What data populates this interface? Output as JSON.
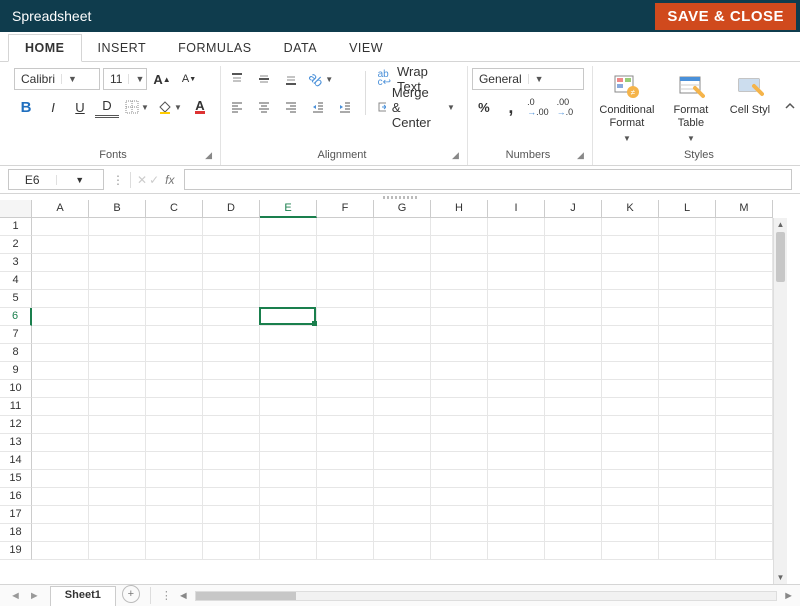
{
  "titlebar": {
    "title": "Spreadsheet",
    "save_close": "SAVE & CLOSE"
  },
  "tabs": {
    "home": "HOME",
    "insert": "INSERT",
    "formulas": "FORMULAS",
    "data": "DATA",
    "view": "VIEW",
    "active": "HOME"
  },
  "ribbon": {
    "fonts": {
      "label": "Fonts",
      "font_name": "Calibri",
      "font_size": "11",
      "bold": "B",
      "italic": "I",
      "underline": "U",
      "dunder": "D"
    },
    "alignment": {
      "label": "Alignment",
      "wrap_text": "Wrap Text",
      "merge_center": "Merge & Center"
    },
    "numbers": {
      "label": "Numbers",
      "format": "General",
      "percent": "%",
      "comma": ","
    },
    "styles": {
      "label": "Styles",
      "conditional": "Conditional Format",
      "format_table": "Format Table",
      "cell_styles": "Cell Styl"
    }
  },
  "namebox": {
    "ref": "E6"
  },
  "grid": {
    "columns": [
      "A",
      "B",
      "C",
      "D",
      "E",
      "F",
      "G",
      "H",
      "I",
      "J",
      "K",
      "L",
      "M"
    ],
    "rows": [
      1,
      2,
      3,
      4,
      5,
      6,
      7,
      8,
      9,
      10,
      11,
      12,
      13,
      14,
      15,
      16,
      17,
      18,
      19
    ],
    "selected": {
      "col": "E",
      "row": 6,
      "colIndex": 4,
      "rowIndex": 5
    }
  },
  "sheets": {
    "active": "Sheet1"
  }
}
